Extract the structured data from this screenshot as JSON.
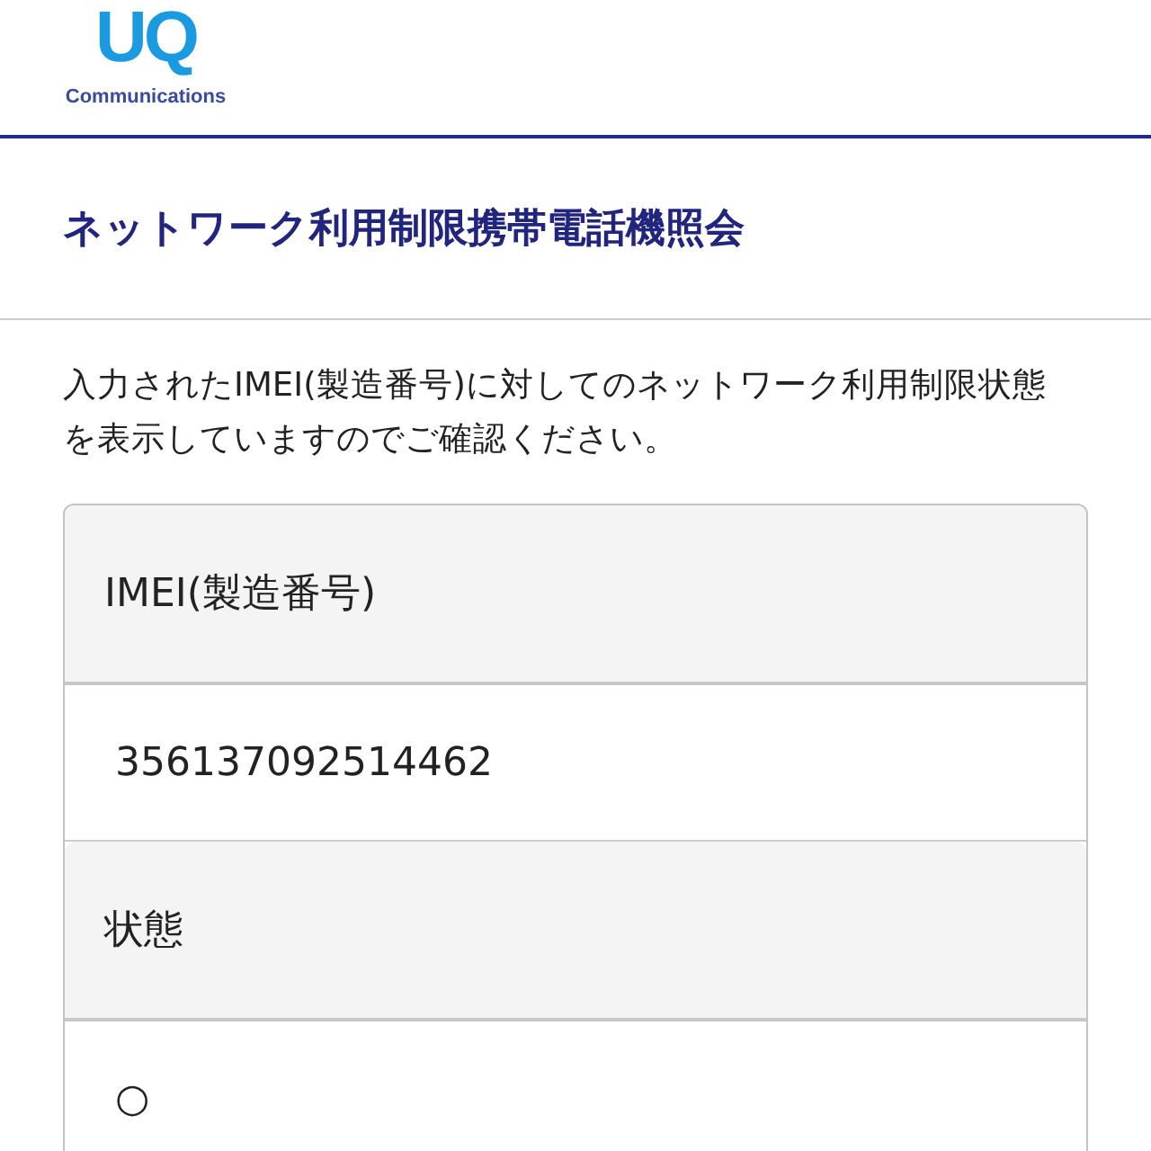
{
  "logo": {
    "mark": "UQ",
    "subtitle": "Communications"
  },
  "title": "ネットワーク利用制限携帯電話機照会",
  "description": "入力されたIMEI(製造番号)に対してのネットワーク利用制限状態を表示していますのでご確認ください。",
  "table": {
    "rows": [
      {
        "label": "IMEI(製造番号)",
        "value": "356137092514462"
      },
      {
        "label": "状態",
        "value": "○"
      }
    ]
  }
}
